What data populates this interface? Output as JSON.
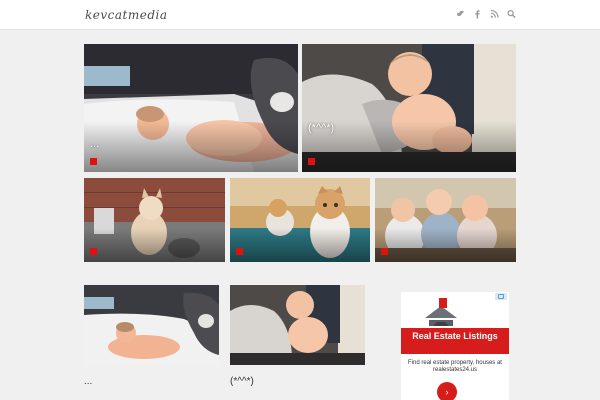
{
  "header": {
    "logo": "kevcatmedia",
    "icons": [
      "twitter-icon",
      "facebook-icon",
      "rss-icon",
      "search-icon"
    ]
  },
  "grid": {
    "tiles": [
      {
        "caption": "..."
      },
      {
        "caption": "(*^^*)"
      },
      {
        "caption": ""
      },
      {
        "caption": ""
      },
      {
        "caption": ""
      }
    ]
  },
  "posts": [
    {
      "title": "..."
    },
    {
      "title": "(*^^*)"
    }
  ],
  "ad": {
    "headline": "Real Estate Listings",
    "body": "Find real estate property, houses at realestates24.us",
    "cta": "›"
  },
  "colors": {
    "accent": "#e31010",
    "ad_red": "#d71c1c",
    "icon_gray": "#9a9a9a"
  }
}
